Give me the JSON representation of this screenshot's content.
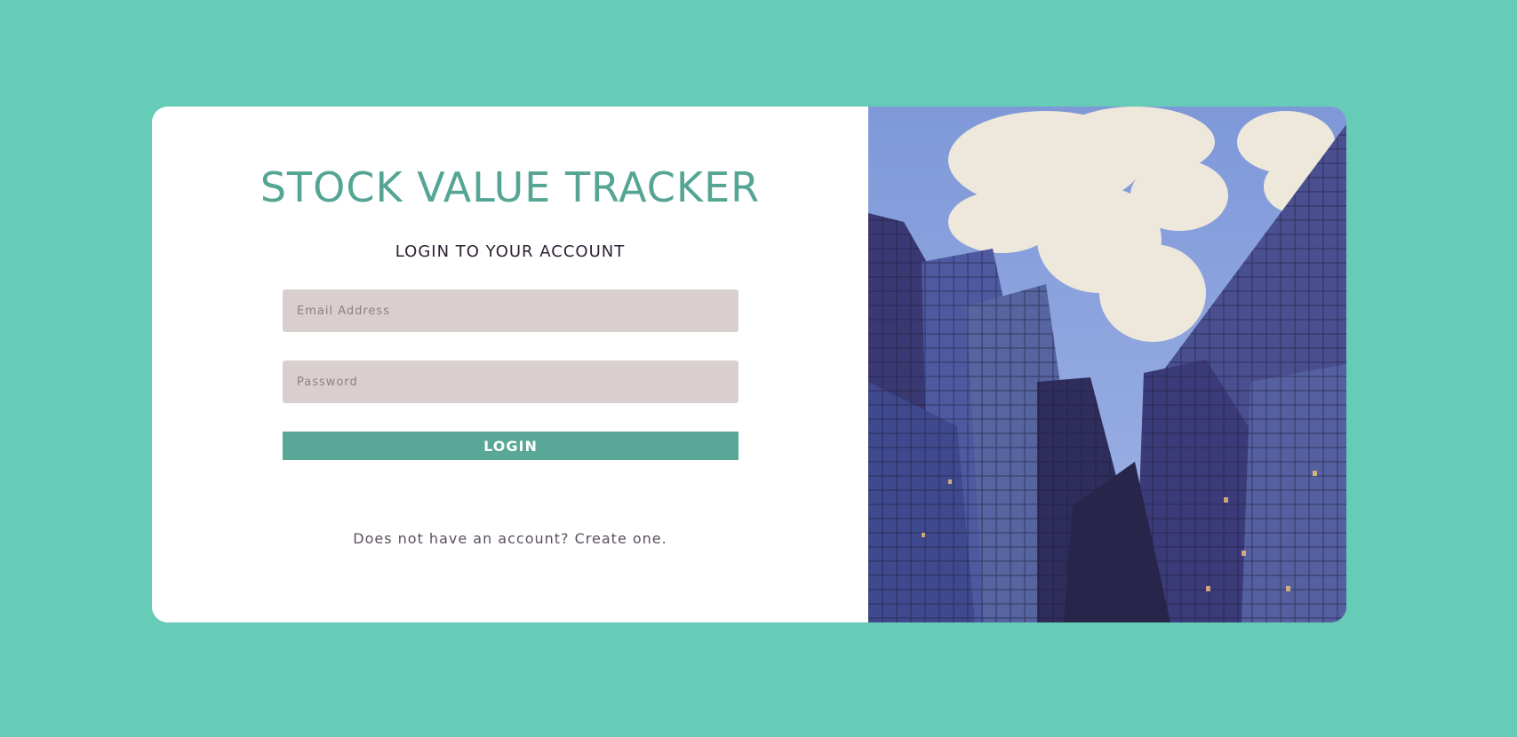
{
  "app_title": "STOCK VALUE TRACKER",
  "subtitle": "LOGIN TO YOUR ACCOUNT",
  "form": {
    "email_placeholder": "Email Address",
    "password_placeholder": "Password",
    "login_label": "LOGIN"
  },
  "signup_text": "Does not have an account? Create one.",
  "image": {
    "subject": "glass skyscrapers against a cloudy blue sky"
  },
  "colors": {
    "background": "#66ccb7",
    "accent": "#59a796",
    "title": "#55a594",
    "field_bg": "#d9cfcf"
  }
}
